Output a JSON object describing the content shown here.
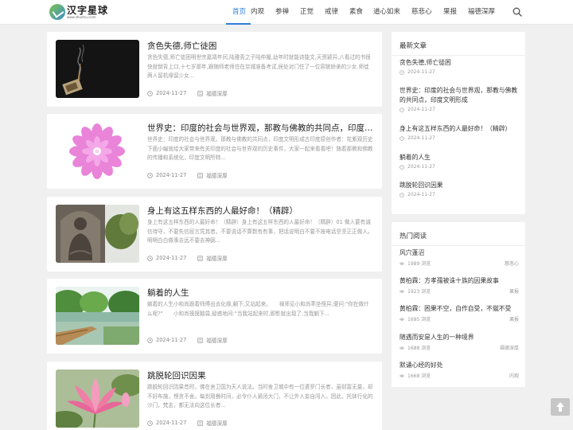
{
  "site": {
    "logo_text": "汉字星球",
    "logo_url_text": "www.zhuntcu.com"
  },
  "nav": {
    "items": [
      {
        "label": "首页"
      },
      {
        "label": "内观"
      },
      {
        "label": "参禅"
      },
      {
        "label": "正觉"
      },
      {
        "label": "戒律"
      },
      {
        "label": "素食"
      },
      {
        "label": "道心如来"
      },
      {
        "label": "慈悲心"
      },
      {
        "label": "果报"
      },
      {
        "label": "福德深厚"
      }
    ]
  },
  "posts": [
    {
      "title": "贪色失德,师亡徒困",
      "excerpt": "贪色失德,师亡徒困明世宗嘉靖年间,陆雅斋之子陆仲履,幼年时就能诗能文,天资颖异,八看过的书很快就倒背上口,十七岁那年,跟随师老师住在京城准备考试,居处对门住了一位容貌娇美的少女.师徒两人留机缘留少女...",
      "date": "2024-11-27",
      "category": "福德深厚"
    },
    {
      "title": "世界史：印度的社会与世界观，那教与佛教的共同点，印度文明形成",
      "excerpt": "世界史：印度的社会与世界观，那教与佛教的共同点，印度文明形成古印度原创作者：花紫观历史下面小编就给大家带来有关印度的社会与世界观的历史事件，大家一起来看看吧！随着那教和佛教的传播和系统化，印度文明所特...",
      "date": "2024-11-27",
      "category": "福德深厚"
    },
    {
      "title": "身上有这五样东西的人最好命！（精辟）",
      "excerpt": "身上有这五样东西的人最好命！（精辟）身上有这五样东西的人最好命！（精辟）01 做人要有诚信待守，不要失信屈言凭其者。不要说话不算数有有事，把话说明白不要不按电话坚坚正正做人。明明白白做事去远不要去神弼...",
      "date": "2024-11-27",
      "category": "福德深厚"
    },
    {
      "title": "躺着的人生",
      "excerpt": "躺着的人生小和尚跟着师傅出去化缘,躺下,又站起来。　　禅师见小和尚乖坐怪异,便问:\"你在做什么呢?\"　　小和尚摸摸脑袋,疑惑地问:\"当我站起来时,即影就出现了;当我躺下...",
      "date": "2024-11-27",
      "category": "福德深厚"
    },
    {
      "title": "跳脱轮回识因果",
      "excerpt": "跳脱轮回识因果昔时，佛在舍卫国为天人说法。当时舍卫城中有一位婆罗门长者，虽财富无量，却不好布施，悭贪不舍。每到用餐时间，必令仆人紧闭大门，不让外人妄自闯入，因此，托钵行化的沙门，梵志，都无法向这位长者...",
      "date": "2024-11-27",
      "category": "福德深厚"
    }
  ],
  "latest": {
    "title": "最新文章",
    "items": [
      {
        "title": "贪色失德,师亡徒困",
        "date": "2024-11-27"
      },
      {
        "title": "世界史：印度的社会与世界观，那教与佛教的共同点，印度文明形成",
        "date": "2024-11-27"
      },
      {
        "title": "身上有这五样东西的人最好命！（精辟）",
        "date": "2024-11-27"
      },
      {
        "title": "躺着的人生",
        "date": "2024-11-27"
      },
      {
        "title": "跳脱轮回识因果",
        "date": "2024-11-27"
      }
    ]
  },
  "hot": {
    "title": "热门阅读",
    "items": [
      {
        "title": "风穴蓬沼",
        "views": "1989 浏览",
        "category": "慈悲心"
      },
      {
        "title": "黄柏霖：方孝孺被诛十族的因果故事",
        "views": "1923 浏览",
        "category": "果报"
      },
      {
        "title": "黄柏霖：困果不空，自作自受，不僦不受",
        "views": "1695 浏览",
        "category": "果报"
      },
      {
        "title": "随遇而安是人生的一种境界",
        "views": "1688 浏览",
        "category": "福德深厚"
      },
      {
        "title": "默诵心经的好处",
        "views": "1668 浏览",
        "category": "内观"
      }
    ]
  },
  "colors": {
    "accent": "#2f7fd8",
    "bg": "#f0f0f0"
  }
}
